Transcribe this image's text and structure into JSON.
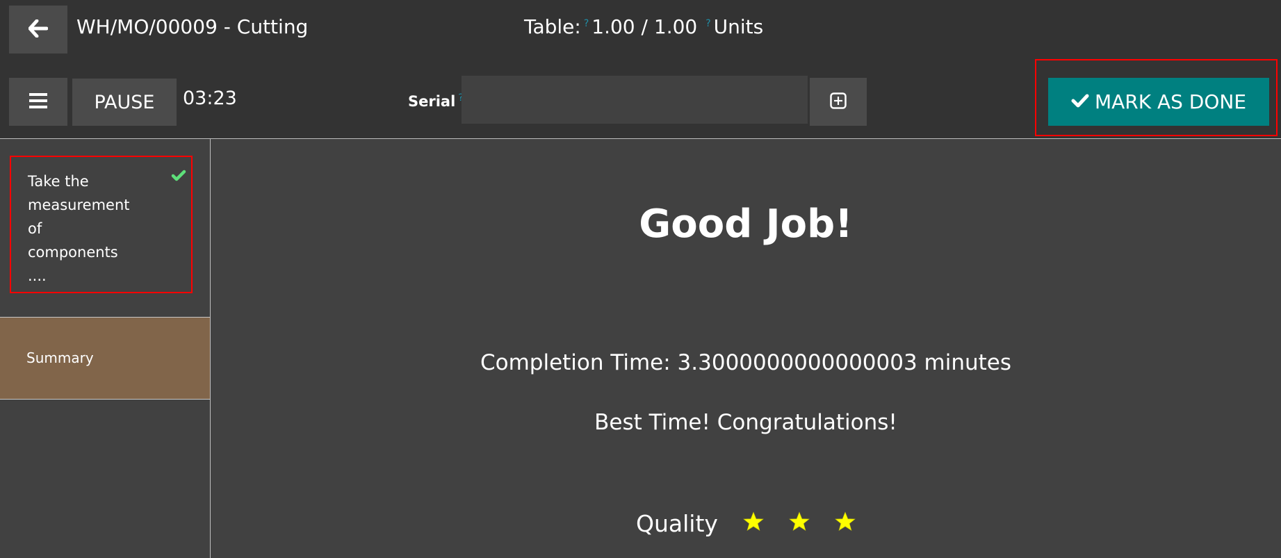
{
  "header": {
    "back_icon": "arrow-left-icon",
    "title": "WH/MO/00009 - Cutting",
    "quantity": {
      "label": "Table:",
      "produced": "1.00",
      "separator": "/",
      "total": "1.00",
      "uom": "Units",
      "help_mark": "?"
    }
  },
  "toolbar": {
    "menu_icon": "hamburger-menu-icon",
    "pause_label": "PAUSE",
    "timer": "03:23",
    "serial_label": "Serial",
    "serial_help": "?",
    "serial_value": "",
    "serial_placeholder": "",
    "add_serial_icon": "plus-square-icon",
    "mark_done_label": "MARK AS DONE",
    "mark_done_icon": "check-icon",
    "accent_color": "#008080"
  },
  "sidebar": {
    "steps": [
      {
        "label_lines": [
          "Take the",
          "measurement",
          "of",
          "components",
          "...."
        ],
        "status_icon": "check-icon",
        "status_color": "#5ee07a",
        "completed": true
      }
    ],
    "summary": {
      "label": "Summary",
      "active": true,
      "color": "#81654a"
    }
  },
  "main": {
    "heading": "Good Job!",
    "completion_time": "Completion Time: 3.3000000000000003 minutes",
    "best_time": "Best Time! Congratulations!",
    "quality": {
      "label": "Quality",
      "stars_filled": 3,
      "stars_total": 3,
      "star_color": "#ffff00"
    }
  }
}
